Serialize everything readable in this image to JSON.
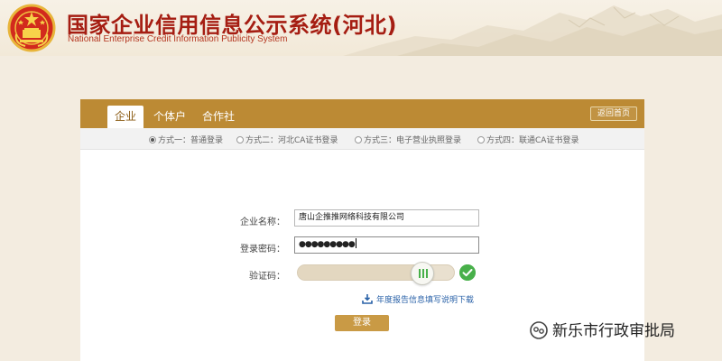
{
  "header": {
    "title": "国家企业信用信息公示系统(河北)",
    "subtitle": "National Enterprise Credit Information Publicity System",
    "emblem_icon": "national-emblem-icon"
  },
  "tabs": [
    {
      "label": "企业",
      "active": true
    },
    {
      "label": "个体户",
      "active": false
    },
    {
      "label": "合作社",
      "active": false
    }
  ],
  "home_button": {
    "label": "返回首页"
  },
  "login_methods": [
    {
      "label": "方式一：普通登录",
      "selected": true
    },
    {
      "label": "方式二：河北CA证书登录",
      "selected": false
    },
    {
      "label": "方式三：电子营业执照登录",
      "selected": false
    },
    {
      "label": "方式四：联通CA证书登录",
      "selected": false
    }
  ],
  "form": {
    "company_name": {
      "label": "企业名称：",
      "value": "唐山企推推网络科技有限公司"
    },
    "password": {
      "label": "登录密码：",
      "value": "●●●●●●●●●"
    },
    "captcha": {
      "label": "验证码：",
      "slider_progress": 0.85,
      "verified": true
    },
    "download_link": "年度报告信息填写说明下载",
    "login_button": "登录"
  },
  "watermark": {
    "text": "新乐市行政审批局",
    "icon": "wechat-official-account-icon"
  },
  "colors": {
    "brand_red": "#a51d12",
    "tab_bar": "#bc8a34",
    "login_button": "#c99a45",
    "success_green": "#48b04a",
    "link_blue": "#2a62a8",
    "page_background": "#f3ece0"
  }
}
